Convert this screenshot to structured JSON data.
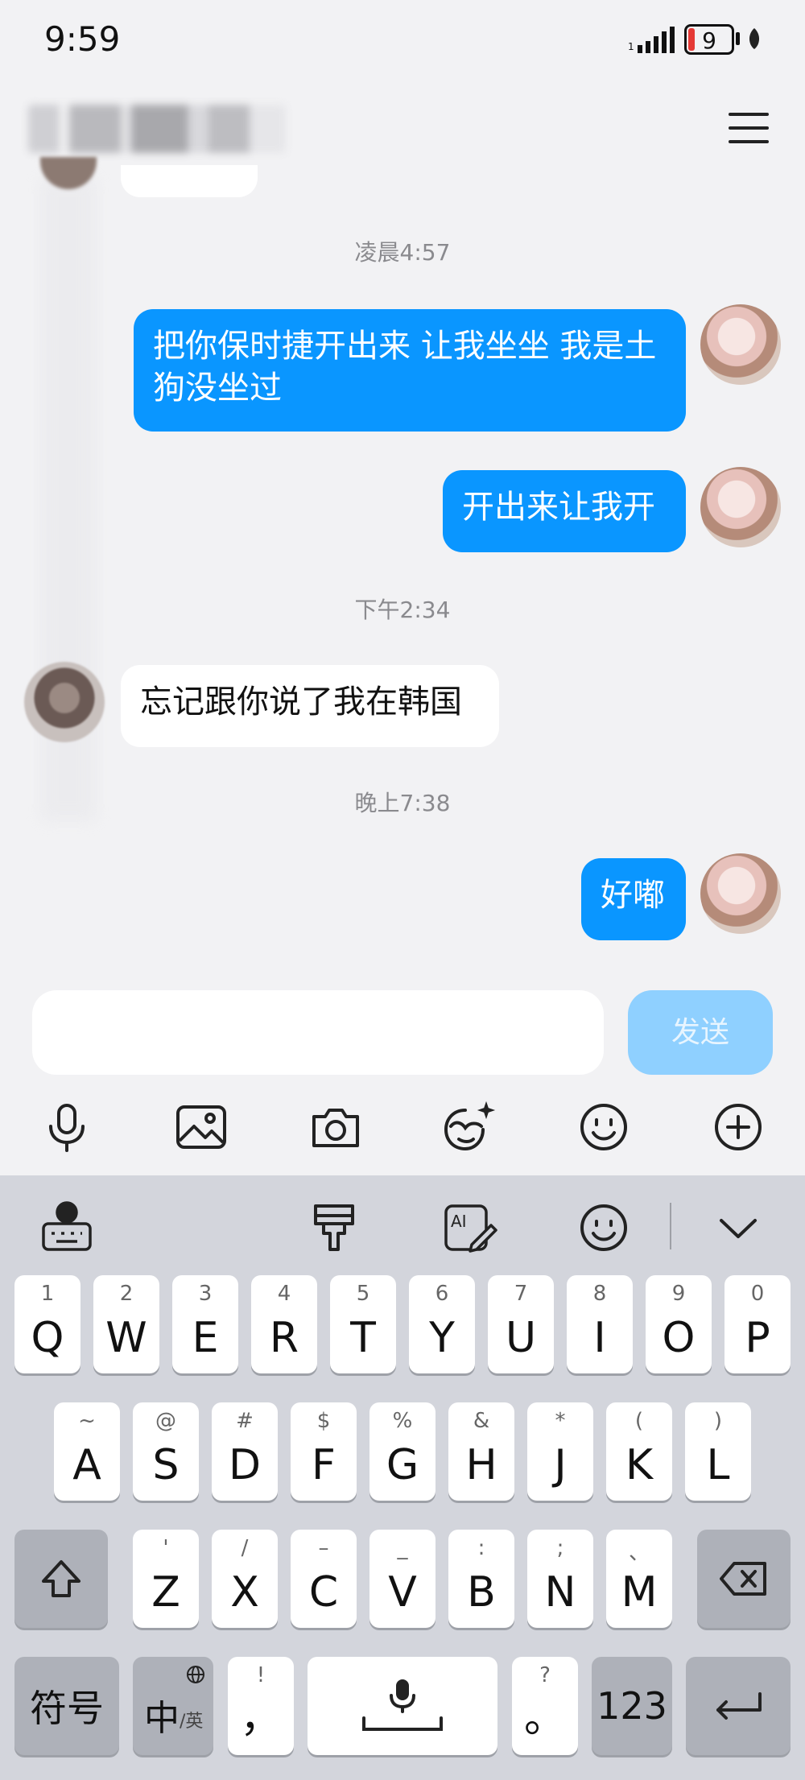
{
  "status": {
    "time": "9:59",
    "battery": "9"
  },
  "chat": {
    "timestamps": [
      "凌晨4:57",
      "下午2:34",
      "晚上7:38"
    ],
    "messages": [
      {
        "from": "me",
        "text": "把你保时捷开出来 让我坐坐 我是土狗没坐过"
      },
      {
        "from": "me",
        "text": "开出来让我开"
      },
      {
        "from": "peer",
        "text": "忘记跟你说了我在韩国"
      },
      {
        "from": "me",
        "text": "好嘟"
      }
    ]
  },
  "input": {
    "value": "",
    "send_label": "发送"
  },
  "tools": [
    "microphone-icon",
    "image-icon",
    "camera-icon",
    "sticker-icon",
    "emoji-icon",
    "plus-icon"
  ],
  "keyboard": {
    "toolbar": [
      "globe-keyboard-icon",
      "brush-icon",
      "ai-edit-icon",
      "emoji-icon",
      "chevron-down-icon"
    ],
    "row1": [
      {
        "main": "Q",
        "sub": "1"
      },
      {
        "main": "W",
        "sub": "2"
      },
      {
        "main": "E",
        "sub": "3"
      },
      {
        "main": "R",
        "sub": "4"
      },
      {
        "main": "T",
        "sub": "5"
      },
      {
        "main": "Y",
        "sub": "6"
      },
      {
        "main": "U",
        "sub": "7"
      },
      {
        "main": "I",
        "sub": "8"
      },
      {
        "main": "O",
        "sub": "9"
      },
      {
        "main": "P",
        "sub": "0"
      }
    ],
    "row2": [
      {
        "main": "A",
        "sub": "~"
      },
      {
        "main": "S",
        "sub": "@"
      },
      {
        "main": "D",
        "sub": "#"
      },
      {
        "main": "F",
        "sub": "$"
      },
      {
        "main": "G",
        "sub": "%"
      },
      {
        "main": "H",
        "sub": "&"
      },
      {
        "main": "J",
        "sub": "*"
      },
      {
        "main": "K",
        "sub": "("
      },
      {
        "main": "L",
        "sub": ")"
      }
    ],
    "row3": [
      {
        "main": "Z",
        "sub": "'"
      },
      {
        "main": "X",
        "sub": "/"
      },
      {
        "main": "C",
        "sub": "–"
      },
      {
        "main": "V",
        "sub": "_"
      },
      {
        "main": "B",
        "sub": ":"
      },
      {
        "main": "N",
        "sub": ";"
      },
      {
        "main": "M",
        "sub": "、"
      }
    ],
    "bottom": {
      "symbols": "符号",
      "lang_main": "中",
      "lang_sub": "/英",
      "comma": "，",
      "comma_sub": "!",
      "period": "。",
      "period_sub": "?",
      "numbers": "123"
    }
  }
}
